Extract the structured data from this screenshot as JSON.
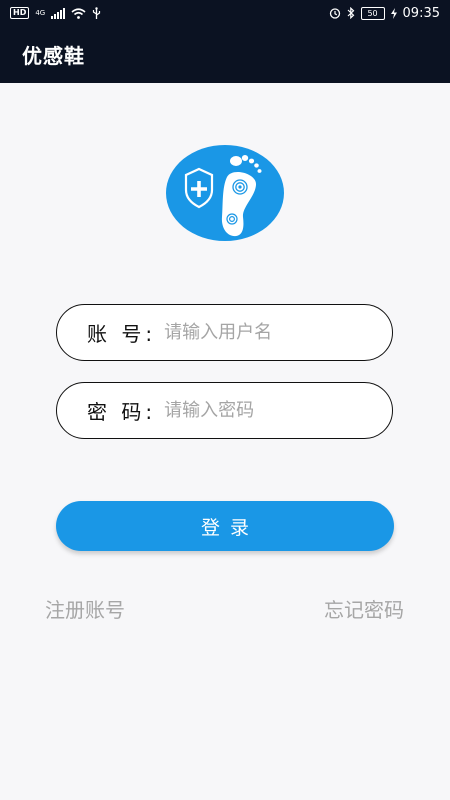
{
  "status_bar": {
    "hd": "HD",
    "network": "4G",
    "battery": "50",
    "time": "09:35",
    "icons": [
      "signal-icon",
      "wifi-icon",
      "usb-icon",
      "alarm-icon",
      "bluetooth-icon",
      "battery-icon",
      "charging-icon"
    ]
  },
  "app_bar": {
    "title": "优感鞋"
  },
  "logo": {
    "icon": "foot-shield-logo-icon",
    "circle_color": "#1a97e6",
    "mark_color": "#ffffff"
  },
  "form": {
    "account": {
      "label": "账 号:",
      "value": "",
      "placeholder": "请输入用户名"
    },
    "password": {
      "label": "密 码:",
      "value": "",
      "placeholder": "请输入密码"
    },
    "login_label": "登录",
    "register_link": "注册账号",
    "forgot_link": "忘记密码"
  },
  "colors": {
    "header_bg": "#0b1222",
    "accent": "#1a97e6",
    "link_text": "#a6a6a6",
    "page_bg": "#f7f7f9"
  }
}
